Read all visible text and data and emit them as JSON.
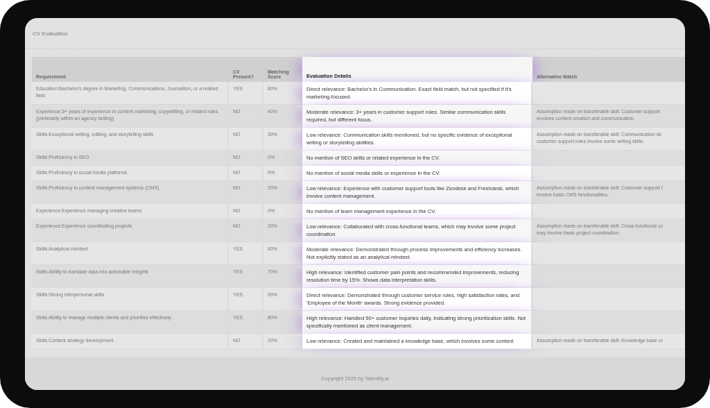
{
  "page": {
    "title": "CV Evaluation"
  },
  "table": {
    "columns": [
      "Requirement",
      "CV Present?",
      "Matching Score",
      "Evaluation Details",
      "Alternative Match"
    ],
    "rows": [
      {
        "requirement": "Education:Bachelor's degree in Marketing, Communications, Journalism, or a related field",
        "present": "YES",
        "score": "80%",
        "details": "Direct relevance: Bachelor's in Communication. Exact field match, but not specified if it's marketing-focused."
      },
      {
        "requirement": "Experience:3+ years of experience in content marketing, copywriting, or related roles (preferably within an agency setting)",
        "present": "NO",
        "score": "40%",
        "details": "Moderate relevance: 3+ years in customer support roles. Similar communication skills required, but different focus.",
        "alternative": "Assumption made on transferable skill: Customer support\ninvolves content creation and communication."
      },
      {
        "requirement": "Skills:Exceptional writing, editing, and storytelling skills",
        "present": "NO",
        "score": "30%",
        "details": "Low relevance: Communication skills mentioned, but no specific evidence of exceptional writing or storytelling abilities.",
        "alternative": "Assumption made on transferable skill: Communication sk\ncustomer support roles involve some writing skills."
      },
      {
        "requirement": "Skills:Proficiency in SEO",
        "present": "NO",
        "score": "0%",
        "details": "No mention of SEO skills or related experience in the CV."
      },
      {
        "requirement": "Skills:Proficiency in social media platforms",
        "present": "NO",
        "score": "0%",
        "details": "No mention of social media skills or experience in the CV."
      },
      {
        "requirement": "Skills:Proficiency in content management systems (CMS)",
        "present": "NO",
        "score": "20%",
        "details": "Low relevance: Experience with customer support tools like Zendesk and Freshdesk, which involve content management.",
        "alternative": "Assumption made on transferable skill: Customer support t\ninvolve basic CMS functionalities."
      },
      {
        "requirement": "Experience:Experience managing creative teams",
        "present": "NO",
        "score": "0%",
        "details": "No mention of team management experience in the CV."
      },
      {
        "requirement": "Experience:Experience coordinating projects",
        "present": "NO",
        "score": "20%",
        "details": "Low relevance: Collaborated with cross-functional teams, which may involve some project coordination.",
        "alternative": "Assumption made on transferable skill: Cross-functional co\nmay involve basic project coordination."
      },
      {
        "requirement": "Skills:Analytical mindset",
        "present": "YES",
        "score": "60%",
        "details": "Moderate relevance: Demonstrated through process improvements and efficiency increases. Not explicitly stated as an analytical mindset."
      },
      {
        "requirement": "Skills:Ability to translate data into actionable insights",
        "present": "YES",
        "score": "70%",
        "details": "High relevance: Identified customer pain points and recommended improvements, reducing resolution time by 15%. Shows data interpretation skills."
      },
      {
        "requirement": "Skills:Strong interpersonal skills",
        "present": "YES",
        "score": "90%",
        "details": "Direct relevance: Demonstrated through customer service roles, high satisfaction rates, and 'Employee of the Month' awards. Strong evidence provided."
      },
      {
        "requirement": "Skills:Ability to manage multiple clients and priorities effectively",
        "present": "YES",
        "score": "80%",
        "details": "High relevance: Handled 50+ customer inquiries daily, indicating strong prioritization skills. Not specifically mentioned as client management."
      },
      {
        "requirement": "Skills:Content strategy development",
        "present": "NO",
        "score": "20%",
        "details": "Low relevance: Created and maintained a knowledge base, which involves some content",
        "alternative": "Assumption made on transferable skill: Knowledge base cr"
      }
    ]
  },
  "footer": {
    "copyright": "Copyright 2025 by Talentify.ai"
  }
}
